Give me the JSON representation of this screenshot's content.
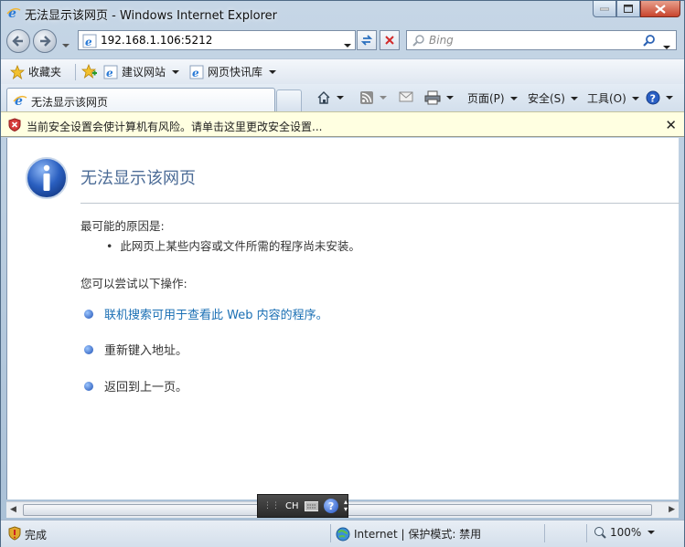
{
  "window": {
    "title": "无法显示该网页 - Windows Internet Explorer"
  },
  "address_bar": {
    "url": "192.168.1.106:5212"
  },
  "search": {
    "placeholder": "Bing"
  },
  "favorites_bar": {
    "favorites_label": "收藏夹",
    "items": [
      {
        "label": "建议网站"
      },
      {
        "label": "网页快讯库"
      }
    ]
  },
  "tab": {
    "label": "无法显示该网页"
  },
  "command_bar": {
    "page_label": "页面(P)",
    "safety_label": "安全(S)",
    "tools_label": "工具(O)"
  },
  "info_bar": {
    "message": "当前安全设置会使计算机有风险。请单击这里更改安全设置...",
    "close_glyph": "✕"
  },
  "error_page": {
    "title": "无法显示该网页",
    "reason_heading": "最可能的原因是:",
    "reasons": [
      "此网页上某些内容或文件所需的程序尚未安装。"
    ],
    "actions_heading": "您可以尝试以下操作:",
    "actions": [
      {
        "text": "联机搜索可用于查看此 Web 内容的程序。",
        "link": true
      },
      {
        "text": "重新键入地址。",
        "link": false
      },
      {
        "text": "返回到上一页。",
        "link": false
      }
    ]
  },
  "language_bar": {
    "code": "CH",
    "help_glyph": "?"
  },
  "status_bar": {
    "status": "完成",
    "zone": "Internet | 保护模式: 禁用",
    "zoom": "100%"
  },
  "colors": {
    "title_blue": "#4b6b96",
    "link_blue": "#1a6fb4",
    "info_bar_bg": "#ffffe1"
  }
}
